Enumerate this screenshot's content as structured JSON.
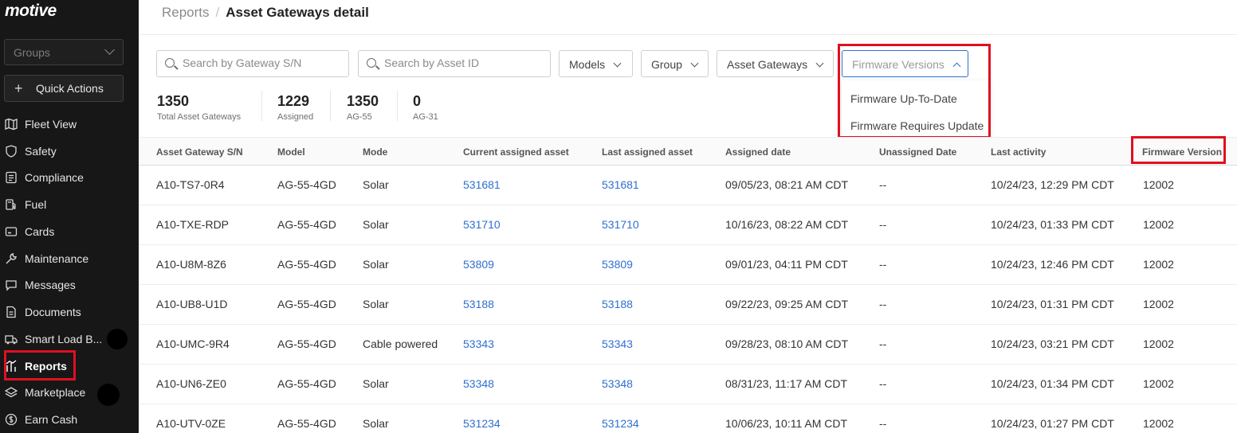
{
  "sidebar": {
    "logo": "motive",
    "groups_placeholder": "Groups",
    "quick_actions": "Quick Actions",
    "items": [
      {
        "label": "Fleet View",
        "icon": "map-icon"
      },
      {
        "label": "Safety",
        "icon": "shield-icon"
      },
      {
        "label": "Compliance",
        "icon": "document-list-icon"
      },
      {
        "label": "Fuel",
        "icon": "fuel-pump-icon"
      },
      {
        "label": "Cards",
        "icon": "card-icon"
      },
      {
        "label": "Maintenance",
        "icon": "wrench-icon"
      },
      {
        "label": "Messages",
        "icon": "chat-icon"
      },
      {
        "label": "Documents",
        "icon": "document-icon"
      },
      {
        "label": "Smart Load B...",
        "icon": "truck-icon"
      },
      {
        "label": "Reports",
        "icon": "reports-icon",
        "active": true
      },
      {
        "label": "Marketplace",
        "icon": "layers-icon"
      },
      {
        "label": "Earn Cash",
        "icon": "dollar-icon"
      }
    ]
  },
  "header": {
    "crumb_parent": "Reports",
    "crumb_sep": "/",
    "title": "Asset Gateways detail"
  },
  "filters": {
    "search_gateway_placeholder": "Search by Gateway S/N",
    "search_asset_placeholder": "Search by Asset ID",
    "models": "Models",
    "group": "Group",
    "asset_gateways": "Asset Gateways",
    "firmware_versions": "Firmware Versions",
    "firmware_options": [
      "Firmware Up-To-Date",
      "Firmware Requires Update"
    ]
  },
  "stats": [
    {
      "value": "1350",
      "caption": "Total Asset Gateways"
    },
    {
      "value": "1229",
      "caption": "Assigned"
    },
    {
      "value": "1350",
      "caption": "AG-55"
    },
    {
      "value": "0",
      "caption": "AG-31"
    }
  ],
  "table": {
    "columns": [
      "Asset Gateway S/N",
      "Model",
      "Mode",
      "Current assigned asset",
      "Last assigned asset",
      "Assigned date",
      "Unassigned Date",
      "Last activity",
      "Firmware Version"
    ],
    "rows": [
      [
        "A10-TS7-0R4",
        "AG-55-4GD",
        "Solar",
        "531681",
        "531681",
        "09/05/23, 08:21 AM CDT",
        "--",
        "10/24/23, 12:29 PM CDT",
        "12002"
      ],
      [
        "A10-TXE-RDP",
        "AG-55-4GD",
        "Solar",
        "531710",
        "531710",
        "10/16/23, 08:22 AM CDT",
        "--",
        "10/24/23, 01:33 PM CDT",
        "12002"
      ],
      [
        "A10-U8M-8Z6",
        "AG-55-4GD",
        "Solar",
        "53809",
        "53809",
        "09/01/23, 04:11 PM CDT",
        "--",
        "10/24/23, 12:46 PM CDT",
        "12002"
      ],
      [
        "A10-UB8-U1D",
        "AG-55-4GD",
        "Solar",
        "53188",
        "53188",
        "09/22/23, 09:25 AM CDT",
        "--",
        "10/24/23, 01:31 PM CDT",
        "12002"
      ],
      [
        "A10-UMC-9R4",
        "AG-55-4GD",
        "Cable powered",
        "53343",
        "53343",
        "09/28/23, 08:10 AM CDT",
        "--",
        "10/24/23, 03:21 PM CDT",
        "12002"
      ],
      [
        "A10-UN6-ZE0",
        "AG-55-4GD",
        "Solar",
        "53348",
        "53348",
        "08/31/23, 11:17 AM CDT",
        "--",
        "10/24/23, 01:34 PM CDT",
        "12002"
      ],
      [
        "A10-UTV-0ZE",
        "AG-55-4GD",
        "Solar",
        "531234",
        "531234",
        "10/06/23, 10:11 AM CDT",
        "--",
        "10/24/23, 01:27 PM CDT",
        "12002"
      ]
    ]
  },
  "colors": {
    "accent": "#2f6fd1",
    "highlight": "#e0101f",
    "sidebar": "#171717"
  }
}
